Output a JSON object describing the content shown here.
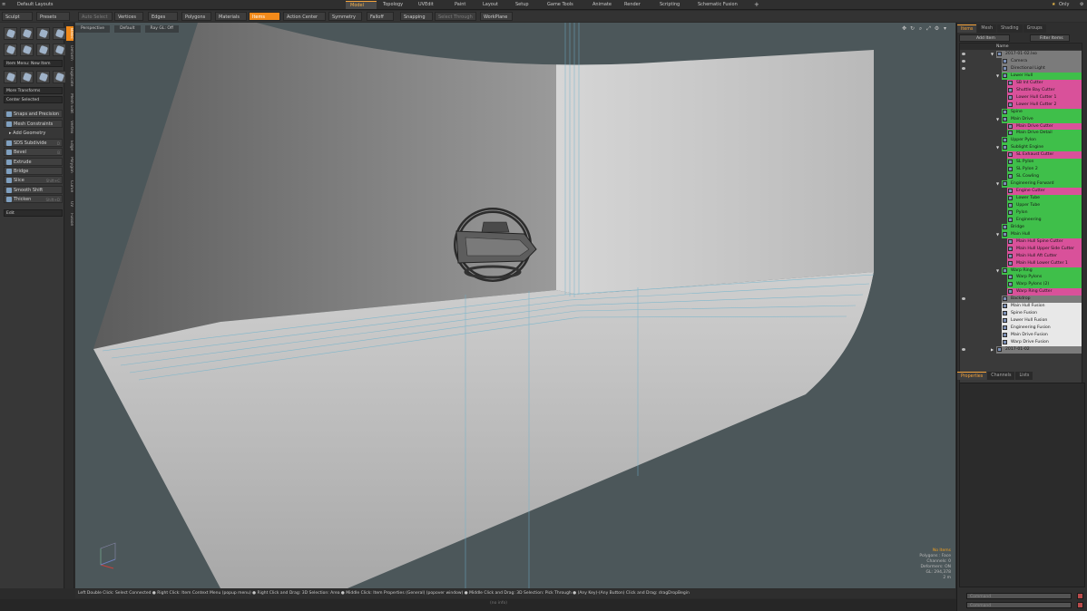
{
  "menu": {
    "layout": "Default Layouts",
    "tabs": [
      "Model",
      "Topology",
      "UVEdit",
      "Paint",
      "Layout",
      "Setup",
      "Game Tools",
      "Animate",
      "Render",
      "Scripting",
      "Schematic Fusion"
    ],
    "active_tab": "Model",
    "add_symbol": "+",
    "only_label": "Only",
    "gear": "⚙"
  },
  "toolbar": {
    "items": [
      {
        "label": "Sculpt",
        "state": "normal"
      },
      {
        "label": "Presets",
        "state": "normal"
      },
      {
        "label": "Auto Select",
        "state": "dim"
      },
      {
        "label": "Vertices",
        "state": "normal"
      },
      {
        "label": "Edges",
        "state": "normal"
      },
      {
        "label": "Polygons",
        "state": "normal"
      },
      {
        "label": "Materials",
        "state": "normal"
      },
      {
        "label": "Items",
        "state": "active"
      },
      {
        "label": "Action Center",
        "state": "normal"
      },
      {
        "label": "Symmetry",
        "state": "normal"
      },
      {
        "label": "Falloff",
        "state": "normal"
      },
      {
        "label": "Snapping",
        "state": "normal"
      },
      {
        "label": "Select Through",
        "state": "dim"
      },
      {
        "label": "WorkPlane",
        "state": "normal"
      }
    ]
  },
  "left": {
    "vtabs": [
      "Basic",
      "Deform",
      "Duplicate",
      "Mesh Edit",
      "Vertex",
      "Edge",
      "Polygon",
      "Curve",
      "UV",
      "Fusion"
    ],
    "item_menu": "Item Menu: New Item",
    "more_transforms": "More Transforms",
    "center_selected": "Center Selected",
    "snaps": "Snaps and Precision",
    "mesh_constraints": "Mesh Constraints",
    "add_geometry": "Add Geometry",
    "tools": [
      {
        "label": "SDS Subdivide",
        "hotkey": "D"
      },
      {
        "label": "Bevel",
        "hotkey": "B"
      },
      {
        "label": "Extrude",
        "hotkey": ""
      },
      {
        "label": "Bridge",
        "hotkey": ""
      },
      {
        "label": "Slice",
        "hotkey": "Shift+C"
      },
      {
        "label": "Smooth Shift",
        "hotkey": ""
      },
      {
        "label": "Thicken",
        "hotkey": "Shift+D"
      }
    ],
    "edit": "Edit"
  },
  "viewport": {
    "view_mode": "Perspective",
    "shading": "Default",
    "render_mode": "Ray GL: Off",
    "stats": {
      "no_items": "No Items",
      "polygons": "Polygons : Face",
      "channels": "Channels: 0",
      "deformers": "Deformers: ON",
      "gl": "GL: 294,378",
      "scale": "2 m"
    }
  },
  "status_bar": "Left Double Click: Select Connected ● Right Click: Item Context Menu (popup menu) ● Right Click and Drag: 3D Selection: Area ● Middle Click: Item Properties (General) (popover window) ● Middle Click and Drag: 3D Selection: Pick Through ● (Any Key)-(Any Button) Click and Drag: dragDropBegin",
  "bottom_info": "(no info)",
  "items_panel": {
    "tabs": [
      "Items",
      "Mesh",
      "Shading",
      "Groups"
    ],
    "active_tab": "Items",
    "add_item": "Add Item",
    "filter_items": "Filter Items",
    "col_name": "Name",
    "rows": [
      {
        "label": "2017-01-02.lxo",
        "indent": 0,
        "color": "gray",
        "tri": "▼",
        "eye": true
      },
      {
        "label": "Camera",
        "indent": 1,
        "color": "gray",
        "tri": "",
        "eye": true
      },
      {
        "label": "Directional Light",
        "indent": 1,
        "color": "gray",
        "tri": "",
        "eye": true
      },
      {
        "label": "Lower Hull",
        "indent": 1,
        "color": "green",
        "tri": "▼",
        "eye": false
      },
      {
        "label": "SB Int Cutter",
        "indent": 2,
        "color": "pink",
        "tri": "",
        "eye": false
      },
      {
        "label": "Shuttle Bay Cutter",
        "indent": 2,
        "color": "pink",
        "tri": "",
        "eye": false
      },
      {
        "label": "Lower Hull Cutter 1",
        "indent": 2,
        "color": "pink",
        "tri": "",
        "eye": false
      },
      {
        "label": "Lower Hull Cutter 2",
        "indent": 2,
        "color": "pink",
        "tri": "",
        "eye": false
      },
      {
        "label": "Spine",
        "indent": 1,
        "color": "green",
        "tri": "",
        "eye": false
      },
      {
        "label": "Main Drive",
        "indent": 1,
        "color": "green",
        "tri": "▼",
        "eye": false
      },
      {
        "label": "Main Drive Cutter",
        "indent": 2,
        "color": "pink",
        "tri": "",
        "eye": false
      },
      {
        "label": "Main Drive Detail",
        "indent": 2,
        "color": "green",
        "tri": "",
        "eye": false
      },
      {
        "label": "Upper Pylon",
        "indent": 1,
        "color": "green",
        "tri": "",
        "eye": false
      },
      {
        "label": "Sublight Engine",
        "indent": 1,
        "color": "green",
        "tri": "▼",
        "eye": false
      },
      {
        "label": "SL Exhaust Cutter",
        "indent": 2,
        "color": "pink",
        "tri": "",
        "eye": false
      },
      {
        "label": "SL Pylon",
        "indent": 2,
        "color": "green",
        "tri": "",
        "eye": false
      },
      {
        "label": "SL Pylon 2",
        "indent": 2,
        "color": "green",
        "tri": "",
        "eye": false
      },
      {
        "label": "SL Cowling",
        "indent": 2,
        "color": "green",
        "tri": "",
        "eye": false
      },
      {
        "label": "Engineering Forward",
        "indent": 1,
        "color": "green",
        "tri": "▼",
        "eye": false
      },
      {
        "label": "Engine Cutter",
        "indent": 2,
        "color": "pink",
        "tri": "",
        "eye": false
      },
      {
        "label": "Lower Tube",
        "indent": 2,
        "color": "green",
        "tri": "",
        "eye": false
      },
      {
        "label": "Upper Tube",
        "indent": 2,
        "color": "green",
        "tri": "",
        "eye": false
      },
      {
        "label": "Pylon",
        "indent": 2,
        "color": "green",
        "tri": "",
        "eye": false
      },
      {
        "label": "Engineering",
        "indent": 2,
        "color": "green",
        "tri": "",
        "eye": false
      },
      {
        "label": "Bridge",
        "indent": 1,
        "color": "green",
        "tri": "",
        "eye": false
      },
      {
        "label": "Main Hull",
        "indent": 1,
        "color": "green",
        "tri": "▼",
        "eye": false
      },
      {
        "label": "Main Hull Spine Cutter",
        "indent": 2,
        "color": "pink",
        "tri": "",
        "eye": false
      },
      {
        "label": "Main Hull Upper Side Cutter",
        "indent": 2,
        "color": "pink",
        "tri": "",
        "eye": false
      },
      {
        "label": "Main Hull Aft Cutter",
        "indent": 2,
        "color": "pink",
        "tri": "",
        "eye": false
      },
      {
        "label": "Main Hull Lower Cutter 1",
        "indent": 2,
        "color": "pink",
        "tri": "",
        "eye": false
      },
      {
        "label": "Warp Ring",
        "indent": 1,
        "color": "green",
        "tri": "▼",
        "eye": false
      },
      {
        "label": "Warp Pylons",
        "indent": 2,
        "color": "green",
        "tri": "",
        "eye": false
      },
      {
        "label": "Warp Pylons (2)",
        "indent": 2,
        "color": "green",
        "tri": "",
        "eye": false
      },
      {
        "label": "Warp Ring Cutter",
        "indent": 2,
        "color": "pink",
        "tri": "",
        "eye": false
      },
      {
        "label": "Backdrop",
        "indent": 1,
        "color": "gray",
        "tri": "",
        "eye": true
      },
      {
        "label": "Main Hull Fusion",
        "indent": 1,
        "color": "white",
        "tri": "",
        "eye": false
      },
      {
        "label": "Spine Fusion",
        "indent": 1,
        "color": "white",
        "tri": "",
        "eye": false
      },
      {
        "label": "Lower Hull Fusion",
        "indent": 1,
        "color": "white",
        "tri": "",
        "eye": false
      },
      {
        "label": "Engineering Fusion",
        "indent": 1,
        "color": "white",
        "tri": "",
        "eye": false
      },
      {
        "label": "Main Drive Fusion",
        "indent": 1,
        "color": "white",
        "tri": "",
        "eye": false
      },
      {
        "label": "Warp Drive Fusion",
        "indent": 1,
        "color": "white",
        "tri": "",
        "eye": false
      },
      {
        "label": "2017-01-02",
        "indent": 0,
        "color": "gray",
        "tri": "▶",
        "eye": true
      }
    ]
  },
  "properties_panel": {
    "tabs": [
      "Properties",
      "Channels",
      "Lists"
    ],
    "active_tab": "Properties",
    "add_symbol": "+"
  },
  "command": {
    "placeholder": "Command"
  },
  "colors": {
    "accent": "#f28a1a",
    "green": "#3fbf4a",
    "pink": "#d9519a",
    "gray": "#7b7b7b",
    "white": "#e8e8e8"
  }
}
